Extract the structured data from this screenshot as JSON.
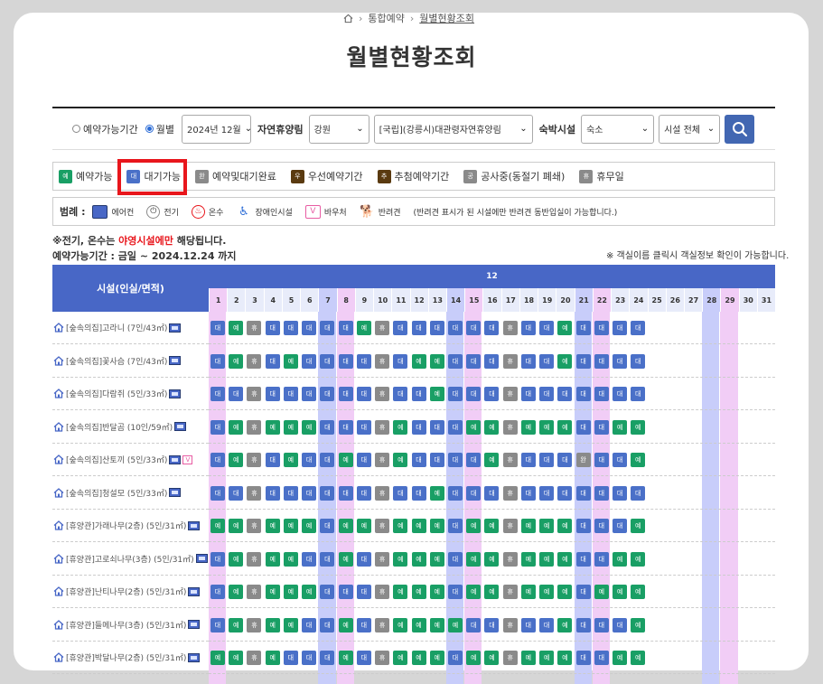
{
  "breadcrumb": {
    "items": [
      "통합예약",
      "월별현황조회"
    ]
  },
  "page_title": "월별현황조회",
  "filters": {
    "radio_available": "예약가능기간",
    "radio_monthly": "월별",
    "month": "2024년 12월",
    "forest_label": "자연휴양림",
    "region": "강원",
    "forest": "[국립](강릉시)대관령자연휴양림",
    "lodging_label": "숙박시설",
    "lodging": "숙소",
    "facility": "시설 전체"
  },
  "status_legend": [
    {
      "badge": "예",
      "label": "예약가능",
      "color": "#199f65"
    },
    {
      "badge": "대",
      "label": "대기가능",
      "color": "#4a70c8"
    },
    {
      "badge": "완",
      "label": "예약및대기완료",
      "color": "#8a8a8a"
    },
    {
      "badge": "우",
      "label": "우선예약기간",
      "color": "#5a3a10"
    },
    {
      "badge": "추",
      "label": "추첨예약기간",
      "color": "#5a3a10"
    },
    {
      "badge": "공",
      "label": "공사중(동절기 폐쇄)",
      "color": "#8a8a8a"
    },
    {
      "badge": "휴",
      "label": "휴무일",
      "color": "#8a8a8a"
    }
  ],
  "icon_legend": {
    "title": "범례 :",
    "items": [
      {
        "icon": "aircon-icon",
        "label": "에어컨"
      },
      {
        "icon": "electricity-icon",
        "label": "전기"
      },
      {
        "icon": "hot-water-icon",
        "label": "온수"
      },
      {
        "icon": "accessible-icon",
        "label": "장애인시설"
      },
      {
        "icon": "voucher-icon",
        "label": "바우처"
      },
      {
        "icon": "pet-icon",
        "label": "반려견"
      }
    ],
    "note": "(반려견 표시가 된 시설에만 반려견 동반입실이 가능합니다.)"
  },
  "notes": {
    "line1_prefix": "※전기, 온수는 ",
    "line1_highlight": "야영시설에만",
    "line1_suffix": " 해당됩니다.",
    "line2": "예약가능기간 : 금일 ~ 2024.12.24 까지",
    "line3": "※ 객실이름 클릭시 객실정보 확인이 가능합니다."
  },
  "table": {
    "facility_header": "시설(인실/면적)",
    "month_header": "12",
    "days": [
      "1",
      "2",
      "3",
      "4",
      "5",
      "6",
      "7",
      "8",
      "9",
      "10",
      "11",
      "12",
      "13",
      "14",
      "15",
      "16",
      "17",
      "18",
      "19",
      "20",
      "21",
      "22",
      "23",
      "24",
      "25",
      "26",
      "27",
      "28",
      "29",
      "30",
      "31"
    ],
    "rows": [
      {
        "name": "[숲속의집]고라니 (7인/43㎡)",
        "icons": [
          "aircon"
        ],
        "cells": [
          "대",
          "예",
          "휴",
          "대",
          "대",
          "대",
          "대",
          "대",
          "예",
          "휴",
          "대",
          "대",
          "대",
          "대",
          "대",
          "대",
          "휴",
          "대",
          "대",
          "예",
          "대",
          "대",
          "대",
          "대"
        ]
      },
      {
        "name": "[숲속의집]꽃사슴 (7인/43㎡)",
        "icons": [
          "aircon"
        ],
        "cells": [
          "대",
          "예",
          "휴",
          "대",
          "예",
          "대",
          "대",
          "대",
          "대",
          "휴",
          "대",
          "예",
          "예",
          "대",
          "대",
          "대",
          "휴",
          "대",
          "대",
          "예",
          "대",
          "대",
          "대",
          "대"
        ]
      },
      {
        "name": "[숲속의집]다람쥐 (5인/33㎡)",
        "icons": [
          "aircon"
        ],
        "cells": [
          "대",
          "대",
          "휴",
          "대",
          "대",
          "대",
          "대",
          "대",
          "대",
          "휴",
          "대",
          "대",
          "예",
          "대",
          "대",
          "대",
          "휴",
          "대",
          "대",
          "대",
          "대",
          "대",
          "대",
          "대"
        ]
      },
      {
        "name": "[숲속의집]반달곰 (10인/59㎡)",
        "icons": [
          "aircon"
        ],
        "cells": [
          "대",
          "예",
          "휴",
          "예",
          "예",
          "예",
          "대",
          "대",
          "대",
          "휴",
          "예",
          "대",
          "대",
          "대",
          "예",
          "예",
          "휴",
          "예",
          "예",
          "예",
          "대",
          "대",
          "예",
          "예"
        ]
      },
      {
        "name": "[숲속의집]산토끼 (5인/33㎡)",
        "icons": [
          "aircon",
          "voucher"
        ],
        "cells": [
          "대",
          "예",
          "휴",
          "대",
          "예",
          "대",
          "대",
          "예",
          "대",
          "휴",
          "예",
          "대",
          "대",
          "대",
          "대",
          "예",
          "휴",
          "대",
          "대",
          "대",
          "완",
          "대",
          "대",
          "예"
        ]
      },
      {
        "name": "[숲속의집]청설모 (5인/33㎡)",
        "icons": [
          "aircon"
        ],
        "cells": [
          "대",
          "대",
          "휴",
          "대",
          "대",
          "대",
          "대",
          "대",
          "대",
          "휴",
          "대",
          "대",
          "예",
          "대",
          "대",
          "대",
          "휴",
          "대",
          "대",
          "대",
          "대",
          "대",
          "대",
          "대"
        ]
      },
      {
        "name": "[휴양관]가래나무(2층) (5인/31㎡)",
        "icons": [
          "aircon"
        ],
        "cells": [
          "예",
          "예",
          "휴",
          "예",
          "예",
          "예",
          "대",
          "예",
          "예",
          "휴",
          "예",
          "예",
          "예",
          "대",
          "예",
          "예",
          "휴",
          "예",
          "예",
          "예",
          "대",
          "대",
          "대",
          "예"
        ]
      },
      {
        "name": "[휴양관]고로쇠나무(3층) (5인/31㎡)",
        "icons": [
          "aircon"
        ],
        "cells": [
          "대",
          "예",
          "휴",
          "예",
          "예",
          "대",
          "대",
          "예",
          "대",
          "휴",
          "예",
          "예",
          "예",
          "대",
          "예",
          "예",
          "휴",
          "예",
          "예",
          "예",
          "대",
          "대",
          "예",
          "예"
        ]
      },
      {
        "name": "[휴양관]난티나무(2층) (5인/31㎡)",
        "icons": [
          "aircon"
        ],
        "cells": [
          "대",
          "예",
          "휴",
          "예",
          "예",
          "예",
          "대",
          "대",
          "대",
          "휴",
          "예",
          "예",
          "예",
          "대",
          "예",
          "예",
          "휴",
          "예",
          "예",
          "예",
          "대",
          "예",
          "예",
          "예"
        ]
      },
      {
        "name": "[휴양관]들메나무(3층) (5인/31㎡)",
        "icons": [
          "aircon"
        ],
        "cells": [
          "대",
          "예",
          "휴",
          "예",
          "예",
          "대",
          "대",
          "예",
          "대",
          "휴",
          "예",
          "예",
          "예",
          "예",
          "대",
          "대",
          "휴",
          "대",
          "대",
          "예",
          "대",
          "대",
          "대",
          "예"
        ]
      },
      {
        "name": "[휴양관]박달나무(2층) (5인/31㎡)",
        "icons": [
          "aircon"
        ],
        "cells": [
          "예",
          "예",
          "휴",
          "예",
          "대",
          "대",
          "대",
          "예",
          "대",
          "휴",
          "예",
          "예",
          "예",
          "대",
          "예",
          "예",
          "휴",
          "예",
          "예",
          "예",
          "대",
          "대",
          "예",
          "예"
        ]
      }
    ]
  },
  "colors": {
    "available": "#199f65",
    "waitable": "#4a70c8",
    "closed": "#8a8a8a",
    "header": "#4867c6",
    "saturday": "#c8cdfa",
    "sunday": "#f1cdf6",
    "highlight": "#e8161c"
  }
}
